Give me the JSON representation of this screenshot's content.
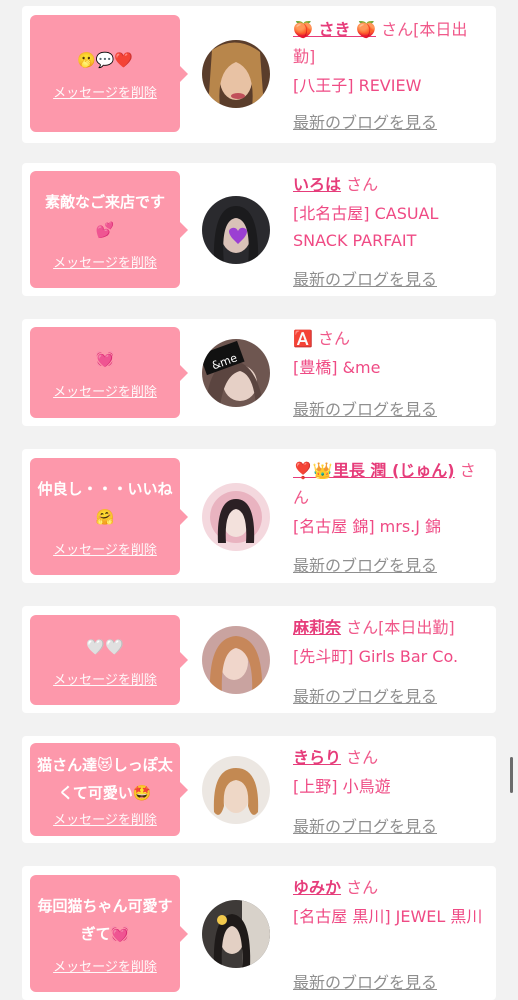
{
  "delete_label": "メッセージを削除",
  "blog_label": "最新のブログを見る",
  "suffix": "さん",
  "cards": [
    {
      "message": "🫢💬❤️",
      "name": "🍑 さき 🍑",
      "suffix_extra": "[本日出勤]",
      "shop": "[八王子] REVIEW"
    },
    {
      "message": "素敵なご来店です💕",
      "name": "いろは",
      "suffix_extra": "",
      "shop": "[北名古屋] CASUAL SNACK PARFAIT"
    },
    {
      "message": "💓",
      "name": "🅰️",
      "suffix_extra": "",
      "shop": "[豊橋] &me"
    },
    {
      "message": "仲良し・・・いいね🤗",
      "name": "❣️👑里長 潤 (じゅん)",
      "suffix_extra": "",
      "shop": "[名古屋 錦] mrs.J 錦"
    },
    {
      "message": "🤍🤍",
      "name": "麻莉奈",
      "suffix_extra": "[本日出勤]",
      "shop": "[先斗町] Girls Bar Co."
    },
    {
      "message": "猫さん達😻しっぽ太くて可愛い🤩",
      "name": "きらり",
      "suffix_extra": "",
      "shop": "[上野] 小鳥遊"
    },
    {
      "message": "毎回猫ちゃん可愛すぎて💓",
      "name": "ゆみか",
      "suffix_extra": "",
      "shop": "[名古屋 黒川] JEWEL 黒川"
    }
  ],
  "colors": {
    "bubble": "#fd98ab",
    "name": "#e63c7a",
    "shop": "#ef4a84",
    "blog": "#8f8f8f",
    "background": "#f2f2f2"
  }
}
